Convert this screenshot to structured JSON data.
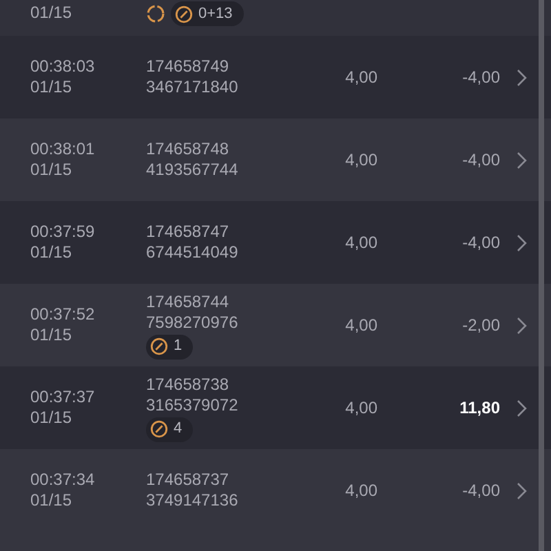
{
  "partial_row": {
    "date": "01/15",
    "badges": [
      {
        "kind": "refresh"
      },
      {
        "kind": "counter",
        "text": "0+13"
      }
    ]
  },
  "rows": [
    {
      "time": "00:38:03",
      "date": "01/15",
      "id1": "174658749",
      "id2": "3467171840",
      "badges": [],
      "stake": "4,00",
      "result": "-4,00",
      "win": false
    },
    {
      "time": "00:38:01",
      "date": "01/15",
      "id1": "174658748",
      "id2": "4193567744",
      "badges": [],
      "stake": "4,00",
      "result": "-4,00",
      "win": false
    },
    {
      "time": "00:37:59",
      "date": "01/15",
      "id1": "174658747",
      "id2": "6744514049",
      "badges": [],
      "stake": "4,00",
      "result": "-4,00",
      "win": false
    },
    {
      "time": "00:37:52",
      "date": "01/15",
      "id1": "174658744",
      "id2": "7598270976",
      "badges": [
        {
          "kind": "counter",
          "text": "1"
        }
      ],
      "stake": "4,00",
      "result": "-2,00",
      "win": false
    },
    {
      "time": "00:37:37",
      "date": "01/15",
      "id1": "174658738",
      "id2": "3165379072",
      "badges": [
        {
          "kind": "counter",
          "text": "4"
        }
      ],
      "stake": "4,00",
      "result": "11,80",
      "win": true
    },
    {
      "time": "00:37:34",
      "date": "01/15",
      "id1": "174658737",
      "id2": "3749147136",
      "badges": [],
      "stake": "4,00",
      "result": "-4,00",
      "win": false
    }
  ]
}
